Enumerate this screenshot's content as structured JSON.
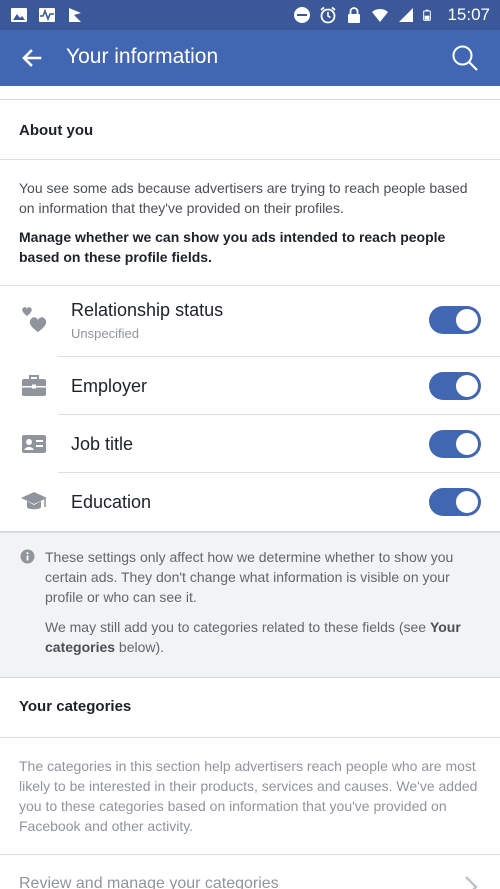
{
  "status_bar": {
    "time": "15:07",
    "left_icons": [
      "image-icon",
      "activity-icon",
      "flag-icon"
    ],
    "right_icons": [
      "do-not-disturb-icon",
      "alarm-icon",
      "lock-icon",
      "wifi-icon",
      "signal-icon",
      "battery-icon"
    ]
  },
  "app_bar": {
    "title": "Your information"
  },
  "about_you": {
    "heading": "About you",
    "description": "You see some ads because advertisers are trying to reach people based on information that they've provided on their profiles.",
    "manage_text": "Manage whether we can show you ads intended to reach people based on these profile fields.",
    "fields": [
      {
        "label": "Relationship status",
        "sublabel": "Unspecified",
        "icon": "hearts-icon",
        "enabled": true
      },
      {
        "label": "Employer",
        "icon": "briefcase-icon",
        "enabled": true
      },
      {
        "label": "Job title",
        "icon": "id-card-icon",
        "enabled": true
      },
      {
        "label": "Education",
        "icon": "graduation-cap-icon",
        "enabled": true
      }
    ]
  },
  "note": {
    "text1": "These settings only affect how we determine whether to show you certain ads. They don't change what information is visible on your profile or who can see it.",
    "text2_prefix": "We may still add you to categories related to these fields (see ",
    "text2_link": "Your categories",
    "text2_suffix": " below)."
  },
  "your_categories": {
    "heading": "Your categories",
    "description": "The categories in this section help advertisers reach people who are most likely to be interested in their products, services and causes. We've added you to these categories based on information that you've provided on Facebook and other activity.",
    "manage_label": "Review and manage your categories"
  },
  "colors": {
    "brand": "#4267b2",
    "status_bar": "#3b5998",
    "toggle_on": "#4267b2"
  }
}
